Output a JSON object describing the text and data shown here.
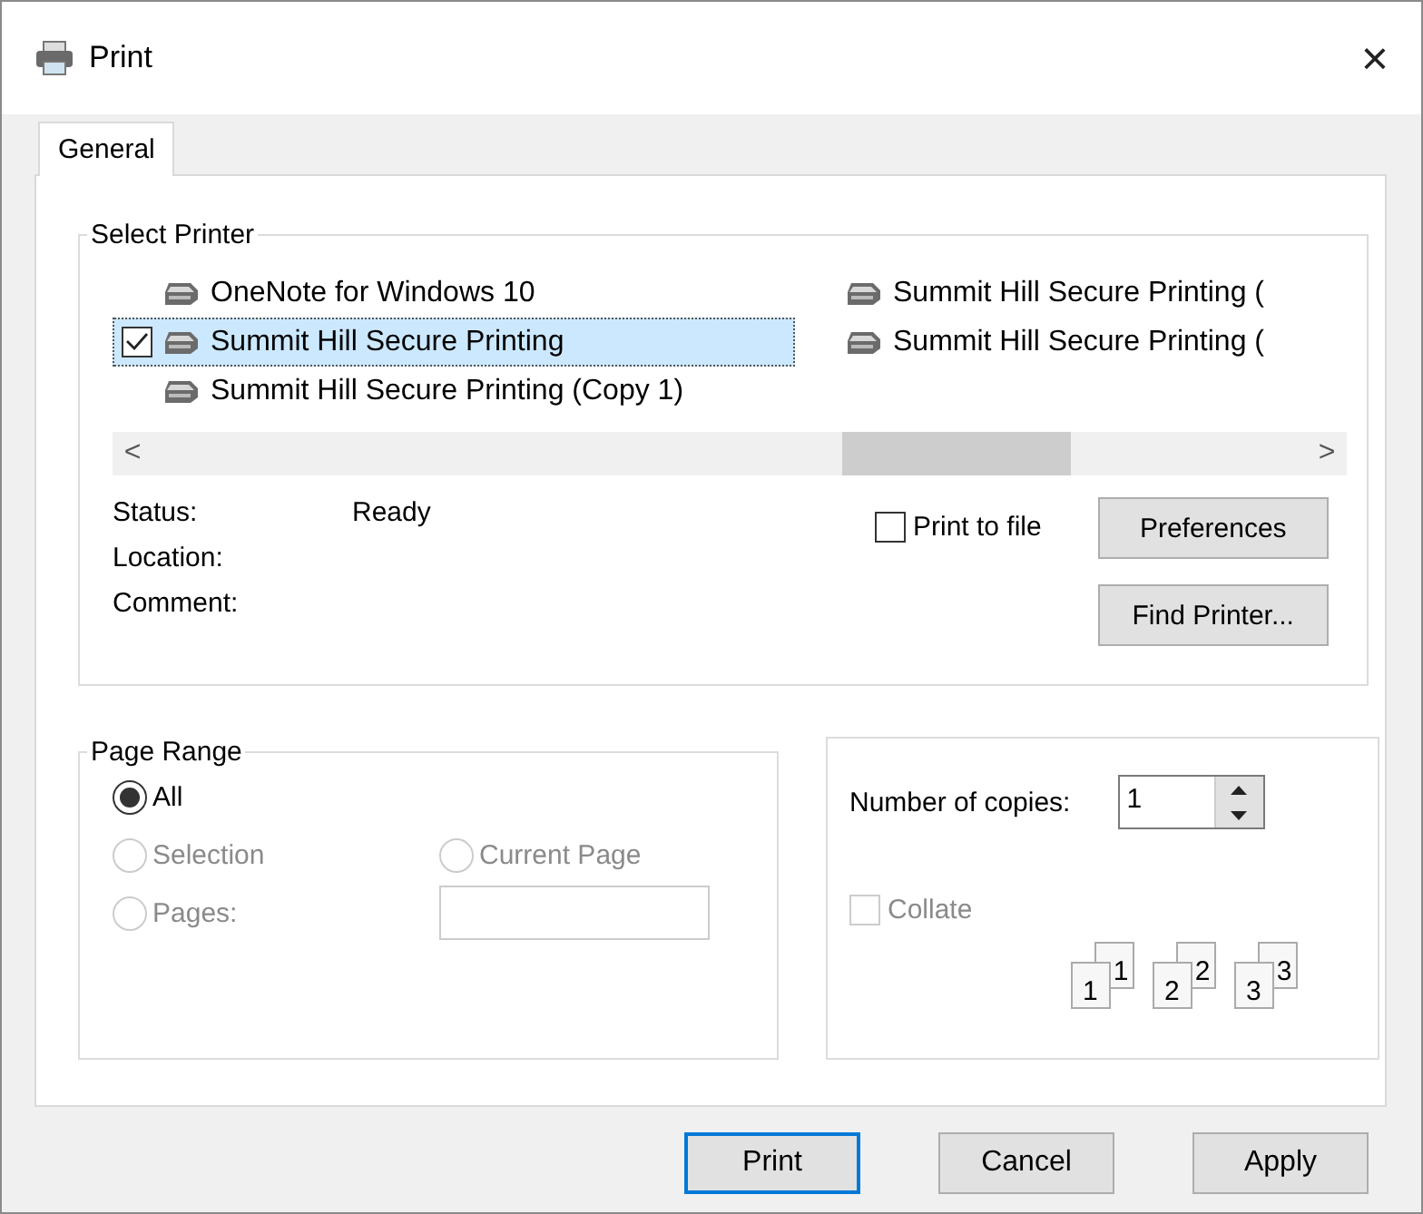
{
  "window": {
    "title": "Print",
    "close": "×"
  },
  "tabs": [
    {
      "label": "General",
      "selected": true
    }
  ],
  "select_printer": {
    "title": "Select Printer",
    "printers": [
      {
        "name": "OneNote for Windows 10",
        "selected": false,
        "checked": false
      },
      {
        "name": "Summit Hill Secure Printing",
        "selected": true,
        "checked": true
      },
      {
        "name": "Summit Hill Secure Printing  (Copy 1)",
        "selected": false,
        "checked": false
      },
      {
        "name": "Summit Hill Secure Printing  (",
        "selected": false,
        "checked": false
      },
      {
        "name": "Summit Hill Secure Printing  (",
        "selected": false,
        "checked": false
      }
    ],
    "scroll_left": "<",
    "scroll_right": ">",
    "info": [
      {
        "label": "Status:",
        "value": "Ready"
      },
      {
        "label": "Location:"
      },
      {
        "label": "Comment:"
      }
    ],
    "print_to_file": {
      "label": "Print to file",
      "checked": false
    },
    "buttons": [
      "Preferences",
      "Find Printer..."
    ]
  },
  "page_range": {
    "title": "Page Range",
    "options": [
      {
        "label": "All",
        "selected": true,
        "disabled": false
      },
      {
        "label": "Selection",
        "selected": false,
        "disabled": true
      },
      {
        "label": "Current Page",
        "selected": false,
        "disabled": true
      },
      {
        "label": "Pages:",
        "selected": false,
        "disabled": true
      }
    ]
  },
  "copies": {
    "label": "Number of copies:",
    "value": "1",
    "collate": {
      "label": "Collate",
      "checked": false,
      "disabled": true
    },
    "collate_pages": [
      {
        "back": "1",
        "front": "1"
      },
      {
        "back": "2",
        "front": "2"
      },
      {
        "back": "3",
        "front": "3"
      }
    ]
  },
  "buttons": [
    {
      "label": "Print",
      "default": true
    },
    {
      "label": "Cancel",
      "default": false
    },
    {
      "label": "Apply",
      "default": false
    }
  ]
}
